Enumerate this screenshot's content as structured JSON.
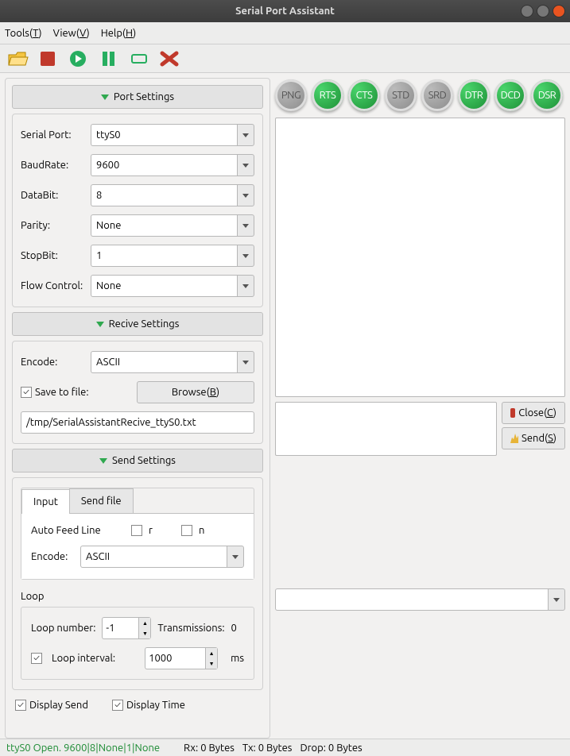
{
  "window": {
    "title": "Serial Port Assistant"
  },
  "menu": {
    "tools": "Tools(",
    "tools_u": "T",
    "view": "View(",
    "view_u": "V",
    "help": "Help(",
    "help_u": "H",
    "close_paren": ")"
  },
  "headers": {
    "port": "Port Settings",
    "recv": "Recive Settings",
    "send": "Send Settings"
  },
  "port": {
    "serial_port_label": "Serial Port:",
    "serial_port": "ttyS0",
    "baud_label": "BaudRate:",
    "baud": "9600",
    "databit_label": "DataBit:",
    "databit": "8",
    "parity_label": "Parity:",
    "parity": "None",
    "stopbit_label": "StopBit:",
    "stopbit": "1",
    "flow_label": "Flow Control:",
    "flow": "None"
  },
  "recv": {
    "encode_label": "Encode:",
    "encode": "ASCII",
    "save_label": "Save to file:",
    "browse": "Browse(",
    "browse_u": "B",
    "path": "/tmp/SerialAssistantRecive_ttyS0.txt"
  },
  "sendtabs": {
    "input": "Input",
    "sendfile": "Send file"
  },
  "input": {
    "autofeed": "Auto Feed Line",
    "r": "r",
    "n": "n",
    "encode_label": "Encode:",
    "encode": "ASCII"
  },
  "loop": {
    "title": "Loop",
    "num_label": "Loop number:",
    "num": "-1",
    "trans_label": "Transmissions:",
    "trans": "0",
    "interval_label": "Loop interval:",
    "interval": "1000",
    "ms": "ms"
  },
  "display": {
    "send": "Display Send",
    "time": "Display Time"
  },
  "leds": [
    "PNG",
    "RTS",
    "CTS",
    "STD",
    "SRD",
    "DTR",
    "DCD",
    "DSR"
  ],
  "led_on": [
    false,
    true,
    true,
    false,
    false,
    true,
    true,
    true
  ],
  "buttons": {
    "close": "Close(",
    "close_u": "C",
    "send": "Send(",
    "send_u": "S"
  },
  "status": {
    "left": "ttyS0 Open. 9600|8|None|1|None",
    "rx": "Rx: 0 Bytes",
    "tx": "Tx: 0 Bytes",
    "drop": "Drop: 0 Bytes"
  }
}
